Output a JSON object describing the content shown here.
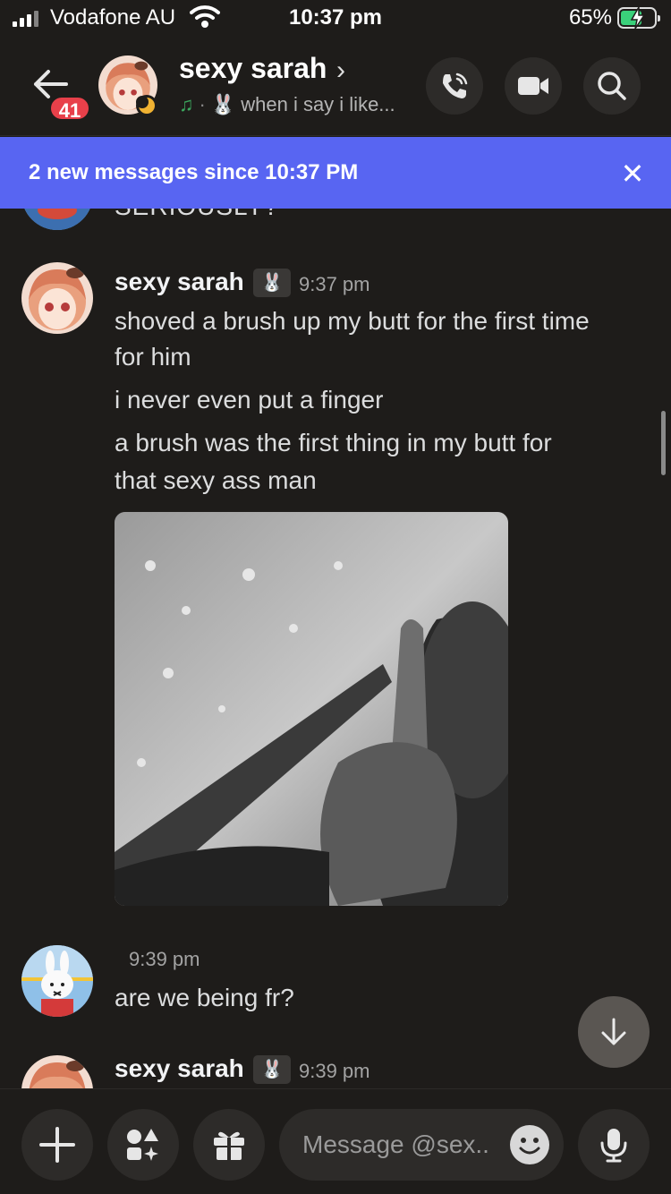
{
  "status_bar": {
    "carrier": "Vodafone AU",
    "time": "10:37 pm",
    "battery_percent": "65%",
    "battery_level": 0.65
  },
  "header": {
    "unread_badge": "41",
    "contact_name": "sexy sarah",
    "custom_status": "when i say i like...",
    "icons": [
      "back-arrow-icon",
      "voice-call-icon",
      "video-camera-icon",
      "search-icon"
    ]
  },
  "banner": {
    "text": "2 new messages since 10:37 PM"
  },
  "messages": [
    {
      "partial_text": "SERIOUSLY?"
    },
    {
      "author": "sexy sarah",
      "time": "9:37 pm",
      "lines": [
        "shoved a brush up my butt for the first time",
        "for him",
        "i never even put a finger",
        "a brush was the first thing in my butt for",
        "that sexy ass man"
      ]
    },
    {
      "time": "9:39 pm",
      "lines": [
        "are we being fr?"
      ]
    },
    {
      "author": "sexy sarah",
      "time": "9:39 pm"
    }
  ],
  "input": {
    "placeholder": "Message @sex.."
  },
  "colors": {
    "background": "#1e1c1a",
    "banner": "#5865f2",
    "badge": "#e8404a"
  }
}
